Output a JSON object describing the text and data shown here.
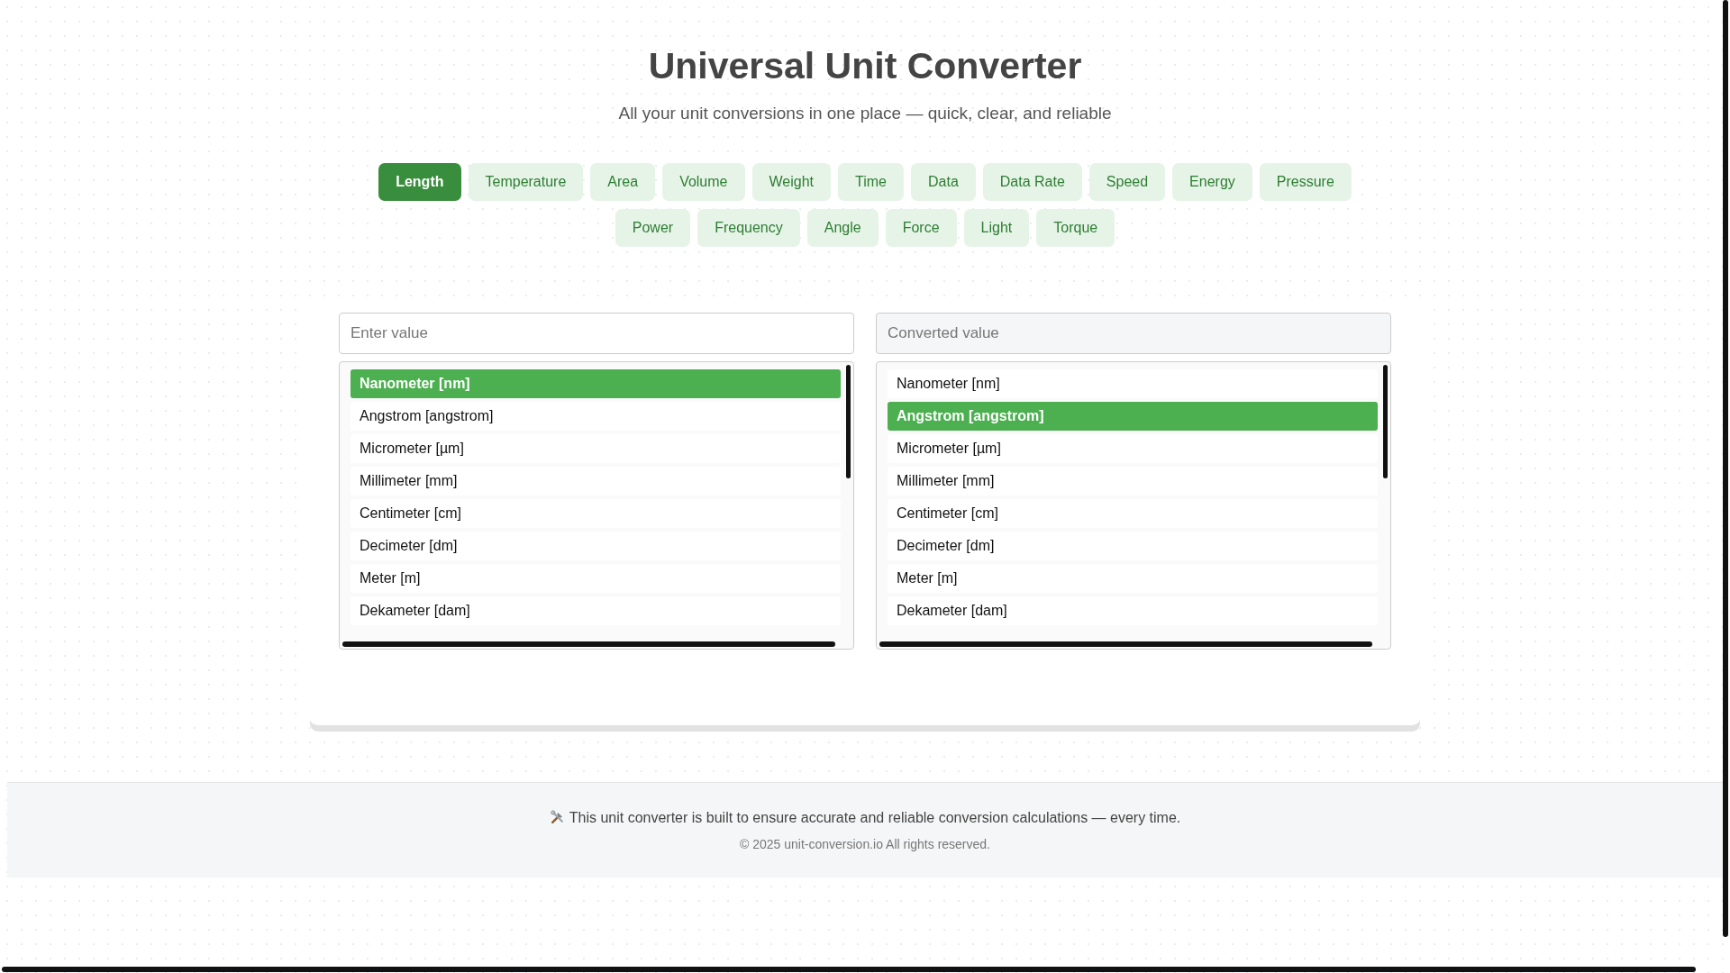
{
  "header": {
    "title": "Universal Unit Converter",
    "subtitle": "All your unit conversions in one place — quick, clear, and reliable"
  },
  "categories": [
    {
      "label": "Length",
      "selected": true
    },
    {
      "label": "Temperature",
      "selected": false
    },
    {
      "label": "Area",
      "selected": false
    },
    {
      "label": "Volume",
      "selected": false
    },
    {
      "label": "Weight",
      "selected": false
    },
    {
      "label": "Time",
      "selected": false
    },
    {
      "label": "Data",
      "selected": false
    },
    {
      "label": "Data Rate",
      "selected": false
    },
    {
      "label": "Speed",
      "selected": false
    },
    {
      "label": "Energy",
      "selected": false
    },
    {
      "label": "Pressure",
      "selected": false
    },
    {
      "label": "Power",
      "selected": false
    },
    {
      "label": "Frequency",
      "selected": false
    },
    {
      "label": "Angle",
      "selected": false
    },
    {
      "label": "Force",
      "selected": false
    },
    {
      "label": "Light",
      "selected": false
    },
    {
      "label": "Torque",
      "selected": false
    }
  ],
  "from": {
    "placeholder": "Enter value",
    "units": [
      {
        "label": "Nanometer [nm]",
        "selected": true
      },
      {
        "label": "Angstrom [angstrom]",
        "selected": false
      },
      {
        "label": "Micrometer [µm]",
        "selected": false
      },
      {
        "label": "Millimeter [mm]",
        "selected": false
      },
      {
        "label": "Centimeter [cm]",
        "selected": false
      },
      {
        "label": "Decimeter [dm]",
        "selected": false
      },
      {
        "label": "Meter [m]",
        "selected": false
      },
      {
        "label": "Dekameter [dam]",
        "selected": false
      }
    ]
  },
  "to": {
    "placeholder": "Converted value",
    "units": [
      {
        "label": "Nanometer [nm]",
        "selected": false
      },
      {
        "label": "Angstrom [angstrom]",
        "selected": true
      },
      {
        "label": "Micrometer [µm]",
        "selected": false
      },
      {
        "label": "Millimeter [mm]",
        "selected": false
      },
      {
        "label": "Centimeter [cm]",
        "selected": false
      },
      {
        "label": "Decimeter [dm]",
        "selected": false
      },
      {
        "label": "Meter [m]",
        "selected": false
      },
      {
        "label": "Dekameter [dam]",
        "selected": false
      }
    ]
  },
  "footer": {
    "note": "This unit converter is built to ensure accurate and reliable conversion calculations — every time.",
    "copyright": "© 2025 unit-conversion.io All rights reserved."
  }
}
